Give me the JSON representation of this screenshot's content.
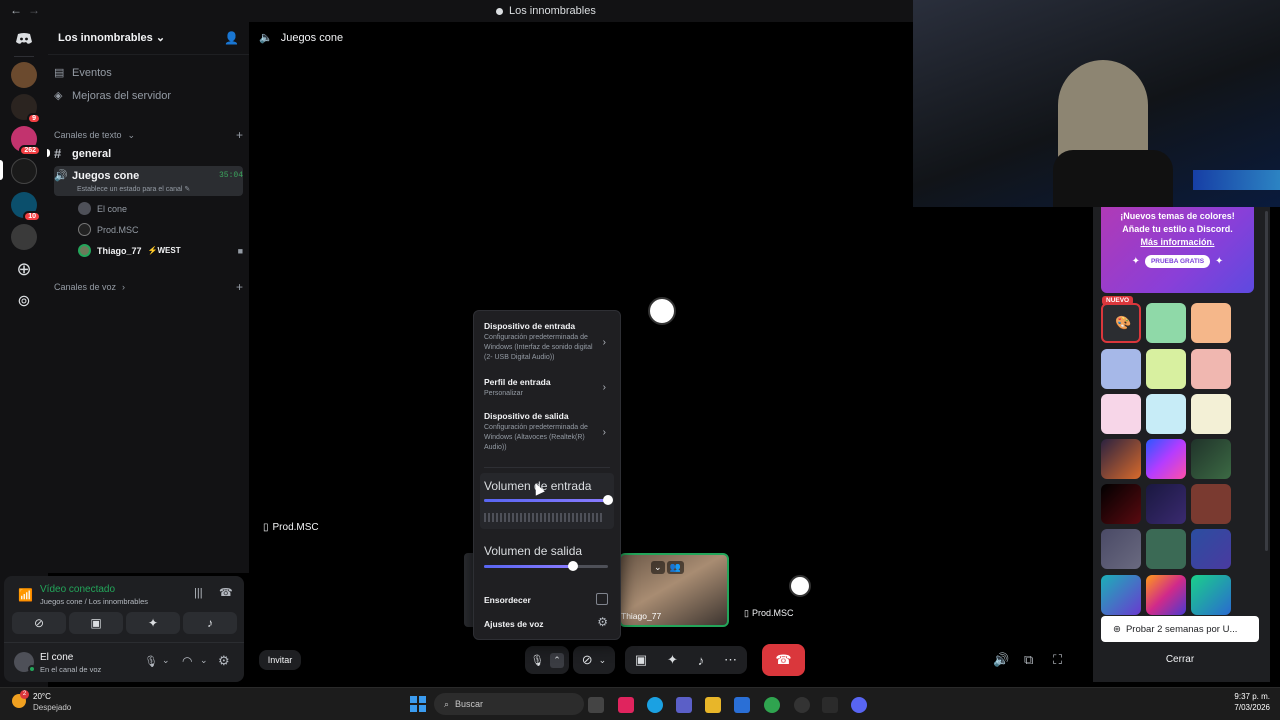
{
  "titlebar": {
    "back": "←",
    "forward": "→",
    "title": "Los innombrables"
  },
  "colors": {
    "accent": "#5865f2",
    "green": "#23a55a",
    "red": "#da373c",
    "voice_green": "#3ba55d"
  },
  "guilds": {
    "badges": [
      "9",
      "262",
      "10"
    ]
  },
  "server": {
    "name": "Los innombrables",
    "events": "Eventos",
    "boosts": "Mejoras del servidor",
    "text_category": "Canales de texto",
    "text_channel": "general",
    "voice_channel": "Juegos cone",
    "voice_timer": "35:04",
    "voice_status": "Establece un estado para el canal",
    "members": [
      "El cone",
      "Prod.MSC",
      "Thiago_77"
    ],
    "member_tag": "⚡WEST",
    "voice_category": "Canales de voz"
  },
  "userpanel": {
    "connected": "Vídeo conectado",
    "location": "Juegos cone / Los innombrables",
    "username": "El cone",
    "status": "En el canal de voz"
  },
  "main": {
    "channel_title": "Juegos cone",
    "tile_label": "Prod.MSC",
    "tile_thiago": "Thiago_77",
    "tile_prod_small": "Prod.MSC",
    "invite": "Invitar"
  },
  "popup": {
    "input_device_title": "Dispositivo de entrada",
    "input_device_sub": "Configuración predeterminada de Windows (Interfaz de sonido digital (2- USB Digital Audio))",
    "input_profile_title": "Perfil de entrada",
    "input_profile_sub": "Personalizar",
    "output_device_title": "Dispositivo de salida",
    "output_device_sub": "Configuración predeterminada de Windows (Altavoces (Realtek(R) Audio))",
    "input_volume": "Volumen de entrada",
    "input_volume_value": 1.0,
    "output_volume": "Volumen de salida",
    "output_volume_value": 0.72,
    "deafen": "Ensordecer",
    "voice_settings": "Ajustes de voz"
  },
  "promo": {
    "line1": "¡Nuevos temas de colores!",
    "line2": "Añade tu estilo a Discord.",
    "link": "Más información.",
    "cta": "PRUEBA GRATIS",
    "new_badge": "NUEVO",
    "trial": "Probar 2 semanas por U...",
    "close": "Cerrar"
  },
  "taskbar": {
    "temp": "20°C",
    "weather": "Despejado",
    "weather_badge": "2",
    "search": "Buscar",
    "time": "9:37 p. m.",
    "date": "7/03/2026"
  }
}
